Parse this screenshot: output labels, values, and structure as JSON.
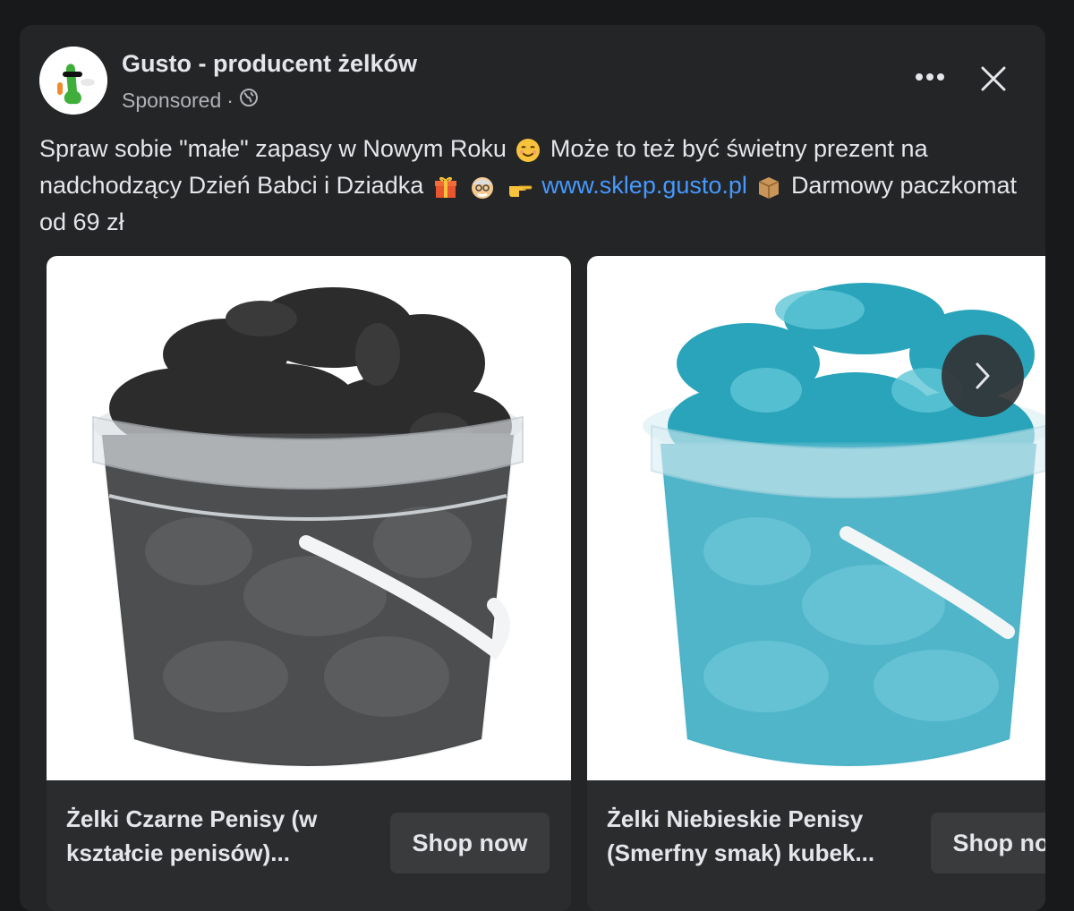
{
  "post": {
    "page_name": "Gusto - producent żelków",
    "sponsored_label": "Sponsored",
    "separator": "·",
    "globe_icon": "globe-icon",
    "more_icon": "more-options-icon",
    "close_icon": "close-icon",
    "text": {
      "part1": "Spraw sobie \"małe\" zapasy w Nowym Roku",
      "part2": "Może to też być świetny prezent na nadchodzący Dzień Babci i Dziadka",
      "link": "www.sklep.gusto.pl",
      "part3": "Darmowy paczkomat od 69 zł"
    },
    "emojis": [
      "smiling-face-icon",
      "gift-icon",
      "old-man-icon",
      "pointing-right-icon",
      "package-icon"
    ]
  },
  "carousel": {
    "cards": [
      {
        "title": "Żelki Czarne Penisy (w kształcie penisów)...",
        "button": "Shop now",
        "product_color": "#2b2b2b"
      },
      {
        "title": "Żelki Niebieskie Penisy (Smerfny smak) kubek...",
        "button": "Shop now",
        "product_color": "#2aa7be"
      }
    ],
    "next_icon": "chevron-right-icon"
  },
  "colors": {
    "background": "#18191a",
    "card": "#242526",
    "text": "#e4e6eb",
    "secondary_text": "#b0b3b8",
    "link": "#4599ff"
  }
}
